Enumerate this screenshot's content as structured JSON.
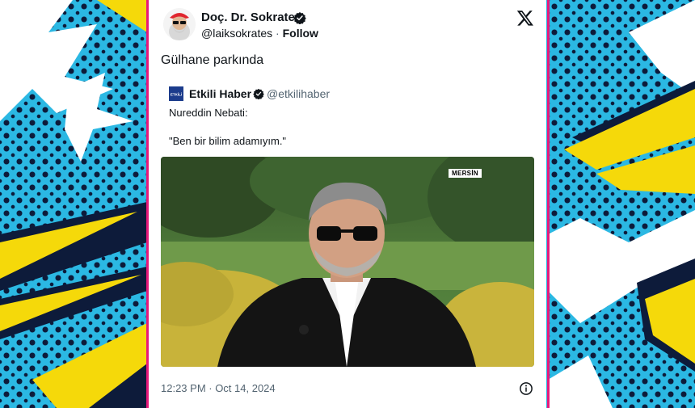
{
  "tweet": {
    "author_name": "Doç. Dr. Sokrates",
    "author_handle": "@laiksokrates",
    "separator": "·",
    "follow_label": "Follow",
    "text": "Gülhane parkında",
    "timestamp": "12:23 PM · Oct 14, 2024"
  },
  "quoted": {
    "logo_text": "ETKİLİ",
    "name": "Etkili Haber",
    "handle": "@etkilihaber",
    "line1": "Nureddin Nebati:",
    "line2": "\"Ben bir bilim adamıyım.\""
  },
  "media": {
    "location_tag": "MERSİN"
  },
  "colors": {
    "border": "#e6197a",
    "panel": "#2bb8e3",
    "verified": "#0f1419"
  },
  "icons": [
    "verified-badge-icon",
    "x-logo-icon",
    "info-icon"
  ]
}
